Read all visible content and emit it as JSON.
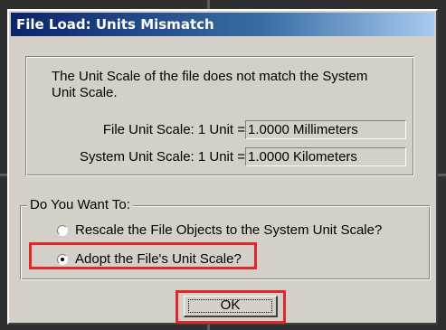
{
  "window": {
    "title": "File Load: Units Mismatch"
  },
  "message": {
    "text": "The Unit Scale of the file does not match the System Unit Scale."
  },
  "file_scale": {
    "label": "File Unit Scale: 1 Unit =",
    "value": "1.0000 Millimeters"
  },
  "system_scale": {
    "label": "System Unit Scale: 1 Unit =",
    "value": "1.0000 Kilometers"
  },
  "options": {
    "legend": "Do You Want To:",
    "rescale_label": "Rescale the File Objects to the System Unit Scale?",
    "rescale_selected": false,
    "adopt_label": "Adopt the File's Unit Scale?",
    "adopt_selected": true
  },
  "buttons": {
    "ok_label": "OK"
  },
  "colors": {
    "dialog_face": "#d4d0c8",
    "titlebar_start": "#0a246a",
    "titlebar_end": "#a6caf0",
    "highlight": "#e0262a"
  }
}
